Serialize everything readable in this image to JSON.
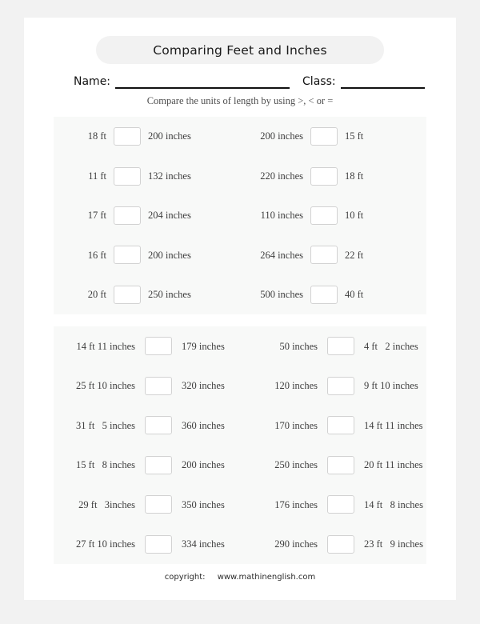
{
  "worksheet": {
    "title": "Comparing Feet and Inches",
    "name_label": "Name:",
    "class_label": "Class:",
    "instruction": "Compare the units of length by using >, < or =",
    "footer": {
      "copyright_label": "copyright:",
      "url": "www.mathinenglish.com"
    }
  },
  "blocks": [
    {
      "id": "block-1",
      "rows": [
        {
          "left": "18 ft",
          "left_answer": "",
          "left_right": "200 inches",
          "right": "200 inches",
          "right_answer": "",
          "right_right": "15 ft"
        },
        {
          "left": "11 ft",
          "left_answer": "",
          "left_right": "132 inches",
          "right": "220 inches",
          "right_answer": "",
          "right_right": "18 ft"
        },
        {
          "left": "17 ft",
          "left_answer": "",
          "left_right": "204 inches",
          "right": "110 inches",
          "right_answer": "",
          "right_right": "10 ft"
        },
        {
          "left": "16 ft",
          "left_answer": "",
          "left_right": "200 inches",
          "right": "264 inches",
          "right_answer": "",
          "right_right": "22 ft"
        },
        {
          "left": "20 ft",
          "left_answer": "",
          "left_right": "250 inches",
          "right": "500 inches",
          "right_answer": "",
          "right_right": "40 ft"
        }
      ]
    },
    {
      "id": "block-2",
      "rows": [
        {
          "left": "14 ft 11 inches",
          "left_answer": "",
          "left_right": "179 inches",
          "right": "50 inches",
          "right_answer": "",
          "right_right": "4 ft   2 inches"
        },
        {
          "left": "25 ft 10 inches",
          "left_answer": "",
          "left_right": "320 inches",
          "right": "120 inches",
          "right_answer": "",
          "right_right": "9 ft 10 inches"
        },
        {
          "left": "31 ft   5 inches",
          "left_answer": "",
          "left_right": "360 inches",
          "right": "170 inches",
          "right_answer": "",
          "right_right": "14 ft 11 inches"
        },
        {
          "left": "15 ft   8 inches",
          "left_answer": "",
          "left_right": "200 inches",
          "right": "250 inches",
          "right_answer": "",
          "right_right": "20 ft 11 inches"
        },
        {
          "left": "29 ft   3inches",
          "left_answer": "",
          "left_right": "350 inches",
          "right": "176 inches",
          "right_answer": "",
          "right_right": "14 ft   8 inches"
        },
        {
          "left": "27 ft 10 inches",
          "left_answer": "",
          "left_right": "334 inches",
          "right": "290 inches",
          "right_answer": "",
          "right_right": "23 ft   9 inches"
        }
      ]
    }
  ]
}
